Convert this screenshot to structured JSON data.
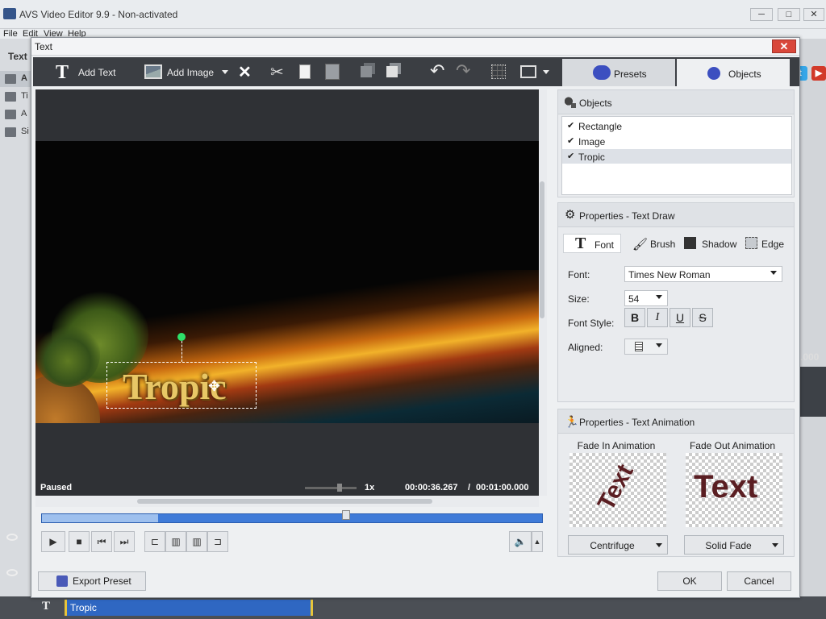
{
  "app": {
    "title": "AVS Video Editor 9.9 - Non-activated",
    "menu": [
      "File",
      "Edit",
      "View",
      "Help"
    ],
    "left_label": "Text",
    "left_items": [
      "A",
      "Ti",
      "A",
      "Si"
    ],
    "time_fragment": ".000",
    "timeline_clip": "Tropic",
    "timeline_track_icon": "T"
  },
  "dialog": {
    "title": "Text",
    "close": "✕",
    "toolbar": {
      "add_text": "Add Text",
      "add_image": "Add Image"
    },
    "tabs": {
      "presets": "Presets",
      "objects": "Objects"
    },
    "preview": {
      "overlay_text": "Tropic",
      "status": "Paused",
      "speed": "1x",
      "current_time": "00:00:36.267",
      "separator": "/",
      "total_time": "00:01:00.000"
    },
    "objects_panel": {
      "title": "Objects",
      "items": [
        {
          "label": "Rectangle",
          "check": "✔"
        },
        {
          "label": "Image",
          "check": "✔"
        },
        {
          "label": "Tropic",
          "check": "✔"
        }
      ]
    },
    "properties_text": {
      "title": "Properties - Text Draw",
      "tabs": [
        "Font",
        "Brush",
        "Shadow",
        "Edge"
      ],
      "font_label": "Font:",
      "font_value": "Times New Roman",
      "size_label": "Size:",
      "size_value": "54",
      "style_label": "Font Style:",
      "style_buttons": [
        "B",
        "I",
        "U",
        "S"
      ],
      "aligned_label": "Aligned:"
    },
    "properties_anim": {
      "title": "Properties - Text Animation",
      "fade_in_title": "Fade In Animation",
      "fade_out_title": "Fade Out Animation",
      "fade_in_preview_text": "Text",
      "fade_out_preview_text": "Text",
      "fade_in_value": "Centrifuge",
      "fade_out_value": "Solid Fade"
    },
    "buttons": {
      "export_preset": "Export Preset",
      "ok": "OK",
      "cancel": "Cancel"
    }
  }
}
